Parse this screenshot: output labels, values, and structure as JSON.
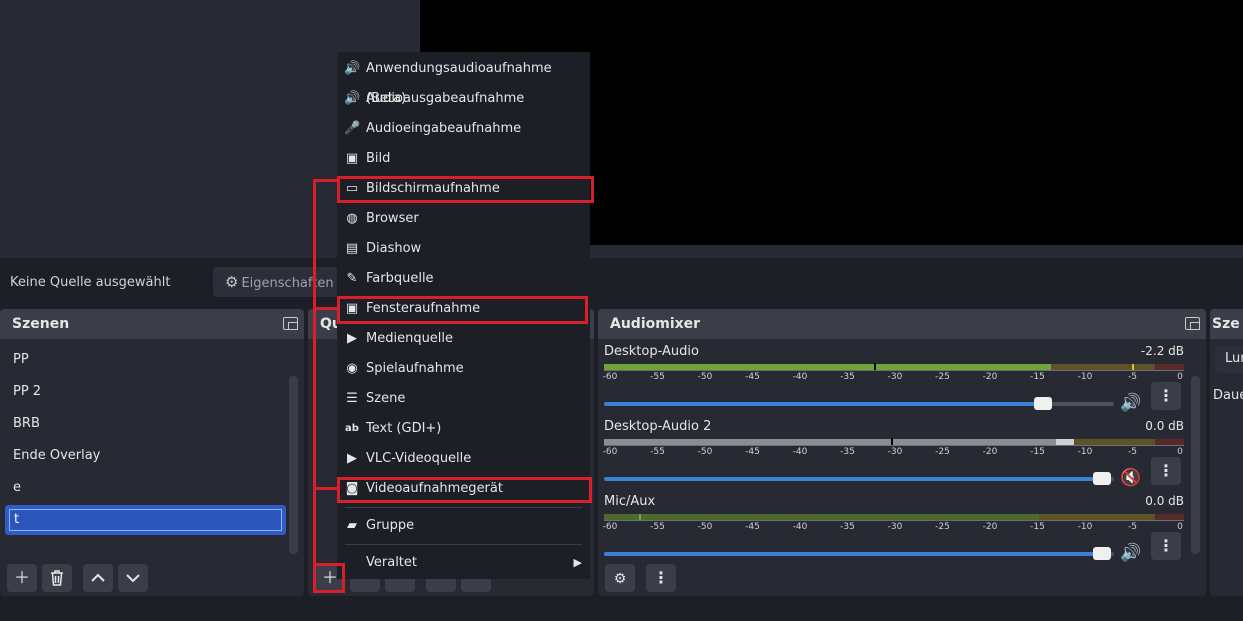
{
  "context_bar": {
    "no_source": "Keine Quelle ausgewählt",
    "properties_label": "Eigenschaften"
  },
  "scenes": {
    "title": "Szenen",
    "items": [
      "PP",
      "PP 2",
      "BRB",
      "Ende Overlay",
      "e"
    ],
    "selected_edit_value": "t"
  },
  "sources": {
    "title": "Qu"
  },
  "mixer": {
    "title": "Audiomixer",
    "ticks": [
      "-60",
      "-55",
      "-50",
      "-45",
      "-40",
      "-35",
      "-30",
      "-25",
      "-20",
      "-15",
      "-10",
      "-5",
      "0"
    ],
    "tracks": [
      {
        "name": "Desktop-Audio",
        "db": "-2.2 dB",
        "volume": 0.88,
        "muted": false
      },
      {
        "name": "Desktop-Audio 2",
        "db": "0.0 dB",
        "volume": 1.0,
        "muted": true
      },
      {
        "name": "Mic/Aux",
        "db": "0.0 dB",
        "volume": 1.0,
        "muted": false
      }
    ]
  },
  "scene_transitions": {
    "title": "Sze",
    "select_value": "Lur",
    "duration_label": "Daue"
  },
  "add_source_menu": {
    "items": [
      {
        "label": "Anwendungsaudioaufnahme (Beta)",
        "icon": "app-audio-icon"
      },
      {
        "label": "Audioausgabeaufnahme",
        "icon": "speaker-icon"
      },
      {
        "label": "Audioeingabeaufnahme",
        "icon": "microphone-icon"
      },
      {
        "label": "Bild",
        "icon": "image-icon"
      },
      {
        "label": "Bildschirmaufnahme",
        "icon": "monitor-icon"
      },
      {
        "label": "Browser",
        "icon": "globe-icon"
      },
      {
        "label": "Diashow",
        "icon": "slideshow-icon"
      },
      {
        "label": "Farbquelle",
        "icon": "paintbrush-icon"
      },
      {
        "label": "Fensteraufnahme",
        "icon": "window-icon"
      },
      {
        "label": "Medienquelle",
        "icon": "play-icon"
      },
      {
        "label": "Spielaufnahme",
        "icon": "gamepad-icon"
      },
      {
        "label": "Szene",
        "icon": "list-icon"
      },
      {
        "label": "Text (GDI+)",
        "icon": "text-icon"
      },
      {
        "label": "VLC-Videoquelle",
        "icon": "play-icon"
      },
      {
        "label": "Videoaufnahmegerät",
        "icon": "camera-icon"
      }
    ],
    "group_label": "Gruppe",
    "deprecated_label": "Veraltet"
  },
  "colors": {
    "accent_blue": "#2f5cc6",
    "highlight_red": "#d8202a",
    "meter_green": "#6ea43a",
    "meter_yellow": "#9a8a2a",
    "meter_red": "#8a3030"
  }
}
